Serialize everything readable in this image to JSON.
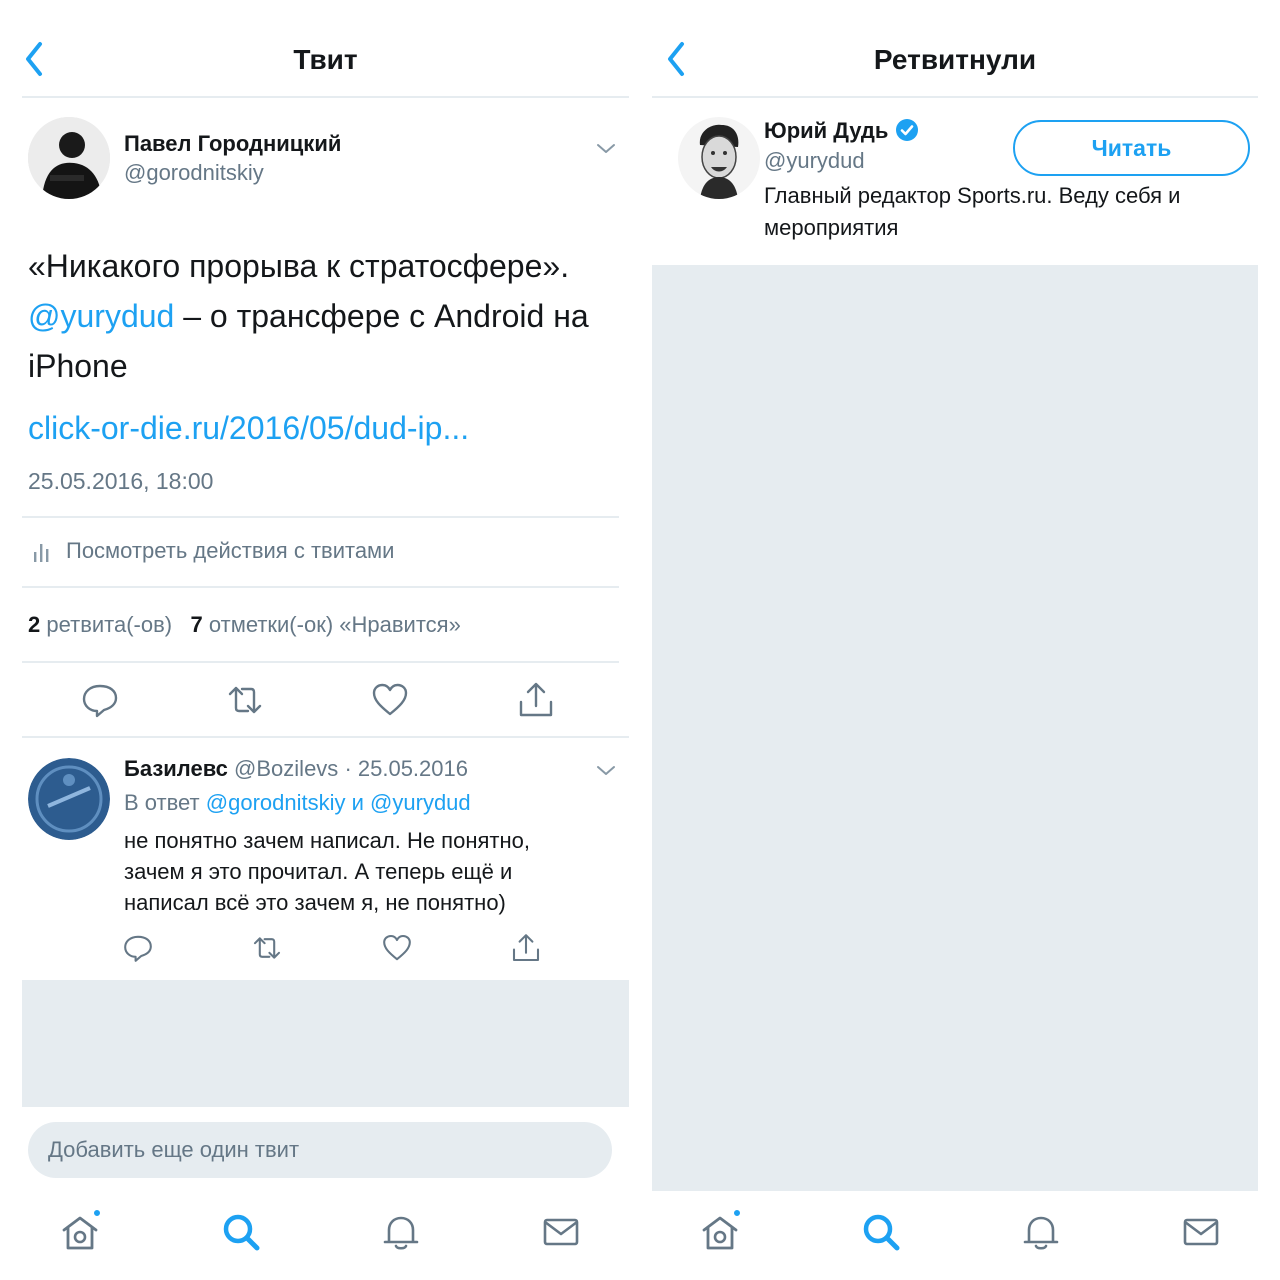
{
  "left": {
    "title": "Твит",
    "tweet": {
      "author_name": "Павел Городницкий",
      "author_handle": "@gorodnitskiy",
      "text_line1": "«Никакого прорыва к стратосфере».",
      "mention": "@yurydud",
      "text_rest": " – о трансфере с Android на",
      "text_line3": "iPhone",
      "link": "click-or-die.ru/2016/05/dud-ip...",
      "timestamp": "25.05.2016, 18:00",
      "analytics_label": "Посмотреть действия с твитами",
      "retweets_count": "2",
      "retweets_label": "ретвита(-ов)",
      "likes_count": "7",
      "likes_label": "отметки(-ок) «Нравится»"
    },
    "reply": {
      "author_name": "Базилевс",
      "author_handle": "@Bozilevs",
      "date": "· 25.05.2016",
      "reply_to_prefix": "В ответ",
      "reply_to_user1": "@gorodnitskiy",
      "reply_to_and": "и",
      "reply_to_user2": "@yurydud",
      "text_line1": "не понятно зачем написал. Не понятно,",
      "text_line2": "зачем я это прочитал. А теперь ещё и",
      "text_line3": "написал всё это зачем я, не понятно)"
    },
    "compose_placeholder": "Добавить еще один твит"
  },
  "right": {
    "title": "Ретвитнули",
    "user": {
      "name": "Юрий Дудь",
      "handle": "@yurydud",
      "bio_line1": "Главный редактор Sports.ru. Веду себя и",
      "bio_line2": "мероприятия",
      "follow_label": "Читать"
    }
  },
  "tabbar": {
    "items": [
      "home-icon",
      "search-icon",
      "notifications-icon",
      "messages-icon"
    ],
    "home_has_badge": true
  },
  "colors": {
    "accent": "#1da1f2",
    "muted": "#657786",
    "text": "#14171a",
    "divider": "#e6ecf0",
    "placeholder_bg": "#e6ecf0"
  }
}
